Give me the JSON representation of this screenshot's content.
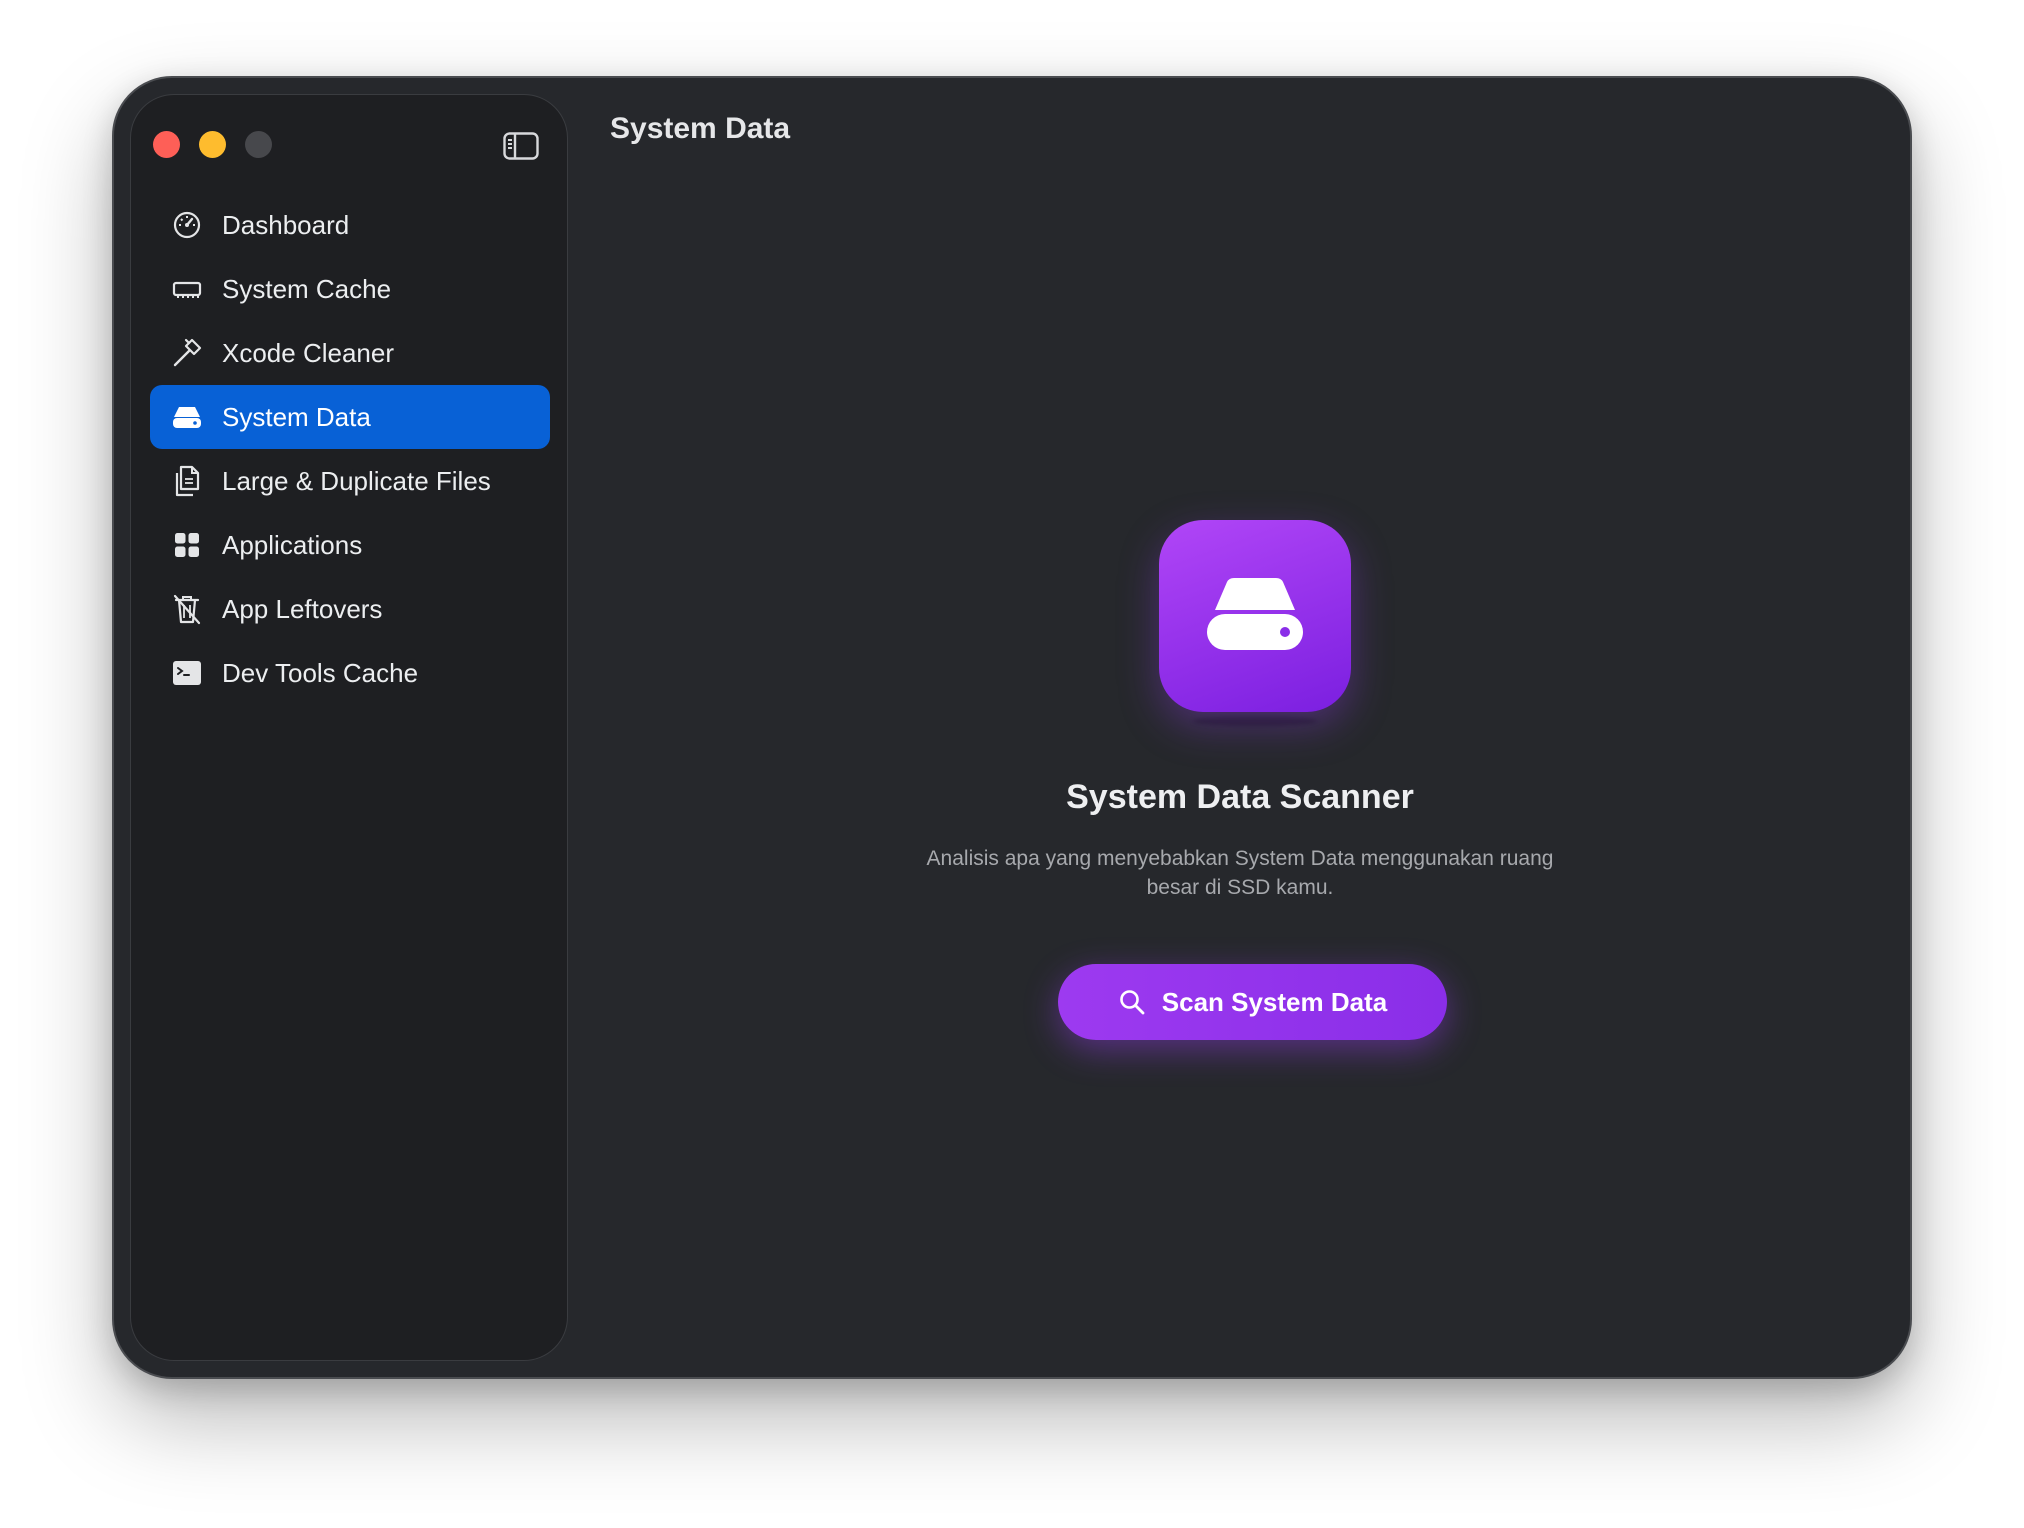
{
  "window": {
    "traffic_lights": [
      "close",
      "minimize",
      "zoom"
    ]
  },
  "sidebar": {
    "toggle_icon": "sidebar-toggle-icon",
    "items": [
      {
        "label": "Dashboard",
        "icon": "gauge-icon",
        "active": false
      },
      {
        "label": "System Cache",
        "icon": "memory-chip-icon",
        "active": false
      },
      {
        "label": "Xcode Cleaner",
        "icon": "hammer-icon",
        "active": false
      },
      {
        "label": "System Data",
        "icon": "drive-icon",
        "active": true
      },
      {
        "label": "Large & Duplicate Files",
        "icon": "documents-icon",
        "active": false
      },
      {
        "label": "Applications",
        "icon": "grid-icon",
        "active": false
      },
      {
        "label": "App Leftovers",
        "icon": "trash-slash-icon",
        "active": false
      },
      {
        "label": "Dev Tools Cache",
        "icon": "terminal-icon",
        "active": false
      }
    ]
  },
  "header": {
    "title": "System Data"
  },
  "main": {
    "hero_icon": "drive-icon",
    "title": "System Data Scanner",
    "description": "Analisis apa yang menyebabkan System Data menggunakan ruang besar di SSD kamu.",
    "scan_button": {
      "label": "Scan System Data",
      "icon": "magnifier-icon"
    }
  },
  "colors": {
    "accent_blue": "#0861d6",
    "accent_purple": "#9d3af0",
    "window_bg": "#26282c",
    "sidebar_bg": "#1e1f22"
  }
}
